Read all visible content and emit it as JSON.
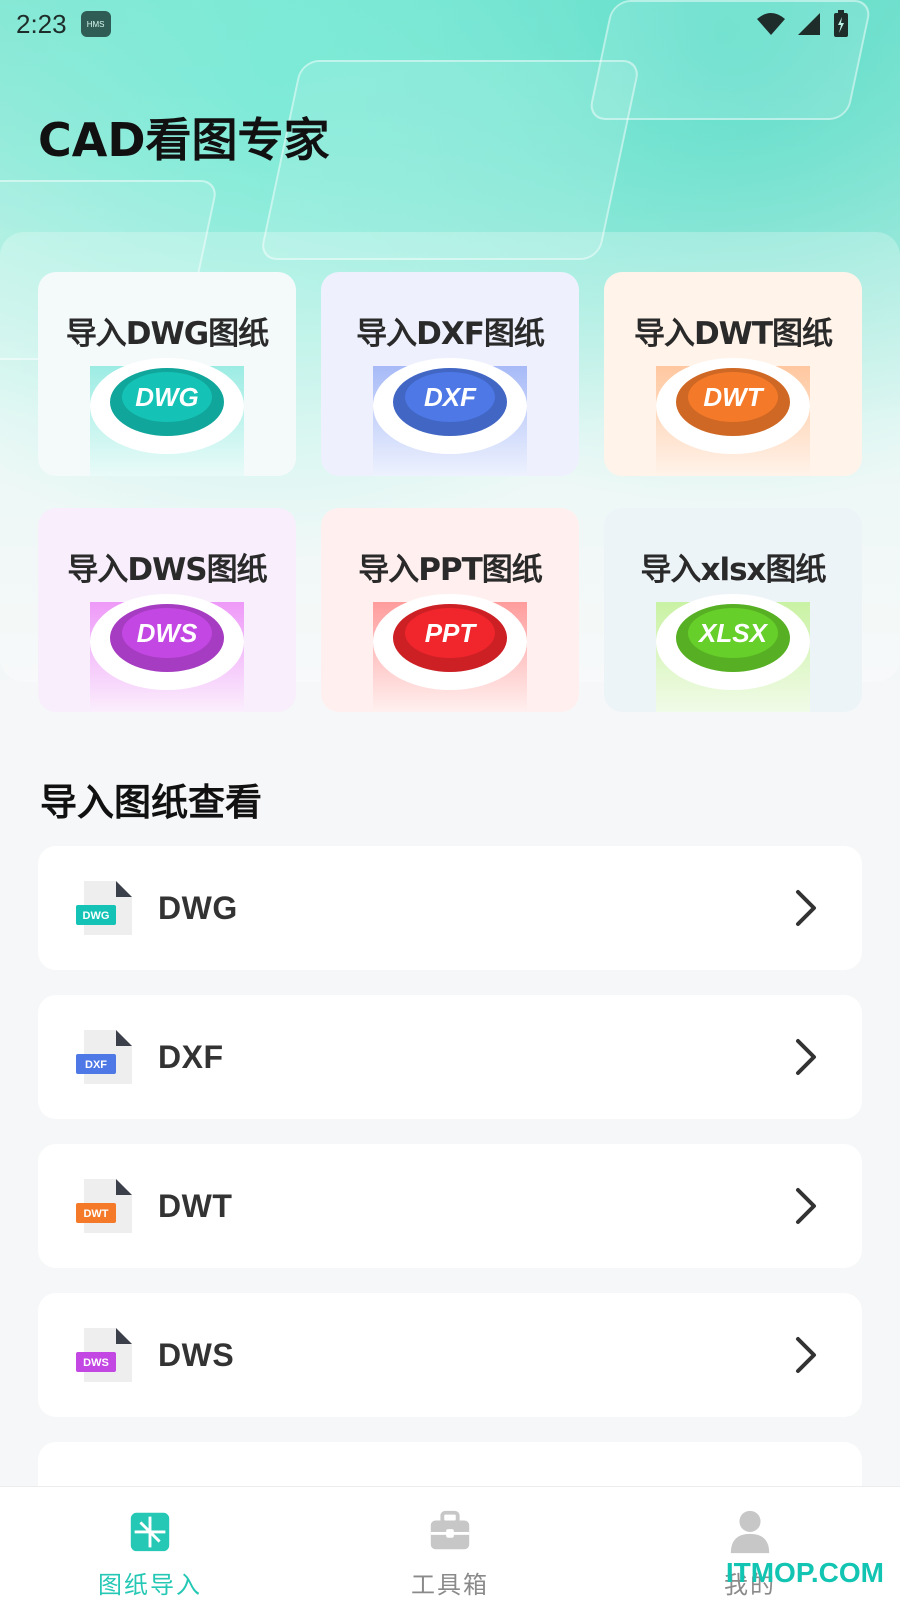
{
  "status_bar": {
    "time": "2:23",
    "badge": "HMS"
  },
  "app": {
    "title": "CAD看图专家"
  },
  "cards": [
    {
      "label": "导入DWG图纸",
      "badge": "DWG",
      "bg": "#f4fafa",
      "top": "#14c3b6",
      "body_top": "#9cece4",
      "body_bottom": "#e9fbf8"
    },
    {
      "label": "导入DXF图纸",
      "badge": "DXF",
      "bg": "#eef1fd",
      "top": "#4d78e6",
      "body_top": "#a7baf7",
      "body_bottom": "#eef2fe"
    },
    {
      "label": "导入DWT图纸",
      "badge": "DWT",
      "bg": "#fff3ea",
      "top": "#f47a2a",
      "body_top": "#ffc79f",
      "body_bottom": "#fff3ea"
    },
    {
      "label": "导入DWS图纸",
      "badge": "DWS",
      "bg": "#f8eefc",
      "top": "#c347e3",
      "body_top": "#ee99f8",
      "body_bottom": "#fbeefd"
    },
    {
      "label": "导入PPT图纸",
      "badge": "PPT",
      "bg": "#fff0ef",
      "top": "#f0262c",
      "body_top": "#ff9c9c",
      "body_bottom": "#fff0ef"
    },
    {
      "label": "导入xlsx图纸",
      "badge": "XLSX",
      "bg": "#edf4f8",
      "top": "#66cf29",
      "body_top": "#c9f2a3",
      "body_bottom": "#f1fbe8"
    }
  ],
  "section": {
    "title": "导入图纸查看"
  },
  "list": [
    {
      "label": "DWG",
      "tag": "DWG",
      "color": "#14c3b6"
    },
    {
      "label": "DXF",
      "tag": "DXF",
      "color": "#4d78e6"
    },
    {
      "label": "DWT",
      "tag": "DWT",
      "color": "#f47a2a"
    },
    {
      "label": "DWS",
      "tag": "DWS",
      "color": "#c347e3"
    }
  ],
  "tabs": [
    {
      "label": "图纸导入",
      "active": true
    },
    {
      "label": "工具箱",
      "active": false
    },
    {
      "label": "我的",
      "active": false
    }
  ],
  "watermark": "ITMOP.COM"
}
